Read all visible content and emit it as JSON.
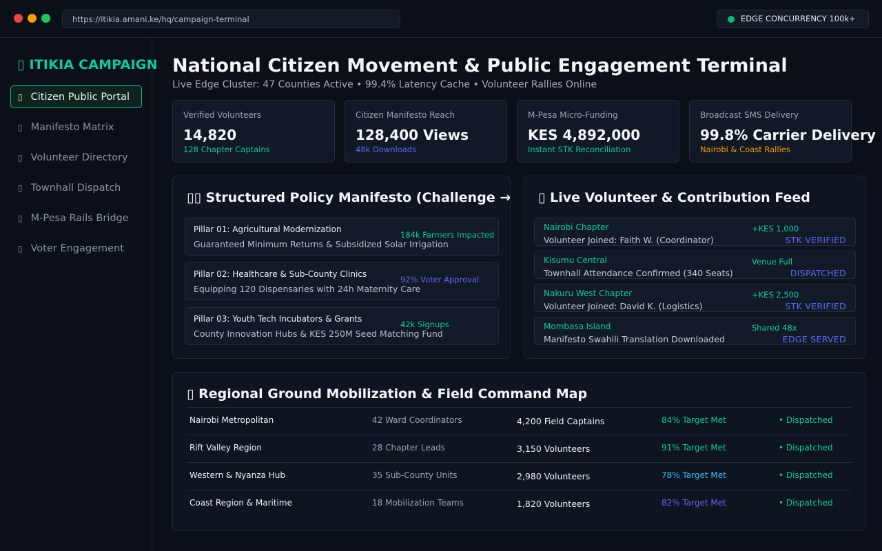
{
  "browser": {
    "url": "https://itikia.amani.ke/hq/campaign-terminal",
    "edge_status": "EDGE CONCURRENCY 100k+"
  },
  "sidebar": {
    "brand": "ITIKIA CAMPAIGN",
    "brand_icon": "glyph-placeholder-icon",
    "items": [
      {
        "label": "Citizen Public Portal",
        "icon": "glyph-placeholder-icon",
        "active": true
      },
      {
        "label": "Manifesto Matrix",
        "icon": "glyph-placeholder-icon",
        "active": false
      },
      {
        "label": "Volunteer Directory",
        "icon": "glyph-placeholder-icon",
        "active": false
      },
      {
        "label": "Townhall Dispatch",
        "icon": "glyph-placeholder-icon",
        "active": false
      },
      {
        "label": "M-Pesa Rails Bridge",
        "icon": "glyph-placeholder-icon",
        "active": false
      },
      {
        "label": "Voter Engagement",
        "icon": "glyph-placeholder-icon",
        "active": false
      }
    ]
  },
  "header": {
    "title": "National Citizen Movement & Public Engagement Terminal",
    "subtitle": "Live Edge Cluster: 47 Counties Active • 99.4% Latency Cache • Volunteer Rallies Online"
  },
  "stats": [
    {
      "label": "Verified Volunteers",
      "value": "14,820",
      "sub": "128 Chapter Captains",
      "sub_color": "#10c8a0"
    },
    {
      "label": "Citizen Manifesto Reach",
      "value": "128,400 Views",
      "sub": "48k Downloads",
      "sub_color": "#6366f1"
    },
    {
      "label": "M-Pesa Micro-Funding",
      "value": "KES 4,892,000",
      "sub": "Instant STK Reconciliation",
      "sub_color": "#10c8a0"
    },
    {
      "label": "Broadcast SMS Delivery",
      "value": "99.8% Carrier Delivery",
      "sub": "Nairobi & Coast Rallies",
      "sub_color": "#f59e0b"
    }
  ],
  "manifesto": {
    "title": "Structured Policy Manifesto (Challenge → Solution)",
    "icon": "glyph-placeholder-icon",
    "pillars": [
      {
        "title": "Pillar 01: Agricultural Modernization",
        "desc": "Guaranteed Minimum Returns & Subsidized Solar Irrigation",
        "metric": "184k Farmers Impacted",
        "metric_color": "#10c8a0"
      },
      {
        "title": "Pillar 02: Healthcare & Sub-County Clinics",
        "desc": "Equipping 120 Dispensaries with 24h Maternity Care",
        "metric": "92% Voter Approval",
        "metric_color": "#6366f1"
      },
      {
        "title": "Pillar 03: Youth Tech Incubators & Grants",
        "desc": "County Innovation Hubs & KES 250M Seed Matching Fund",
        "metric": "42k Signups",
        "metric_color": "#10c8a0"
      }
    ]
  },
  "feed": {
    "title": "Live Volunteer & Contribution Feed",
    "icon": "glyph-placeholder-icon",
    "items": [
      {
        "chapter": "Nairobi Chapter",
        "desc": "Volunteer Joined: Faith W. (Coordinator)",
        "amount": "+KES 1,000",
        "status": "STK VERIFIED"
      },
      {
        "chapter": "Kisumu Central",
        "desc": "Townhall Attendance Confirmed (340 Seats)",
        "amount": "Venue Full",
        "status": "DISPATCHED"
      },
      {
        "chapter": "Nakuru West Chapter",
        "desc": "Volunteer Joined: David K. (Logistics)",
        "amount": "+KES 2,500",
        "status": "STK VERIFIED"
      },
      {
        "chapter": "Mombasa Island",
        "desc": "Manifesto Swahili Translation Downloaded",
        "amount": "Shared 48x",
        "status": "EDGE SERVED"
      }
    ]
  },
  "map": {
    "title": "Regional Ground Mobilization & Field Command Map",
    "icon": "glyph-placeholder-icon",
    "rows": [
      {
        "region": "Nairobi Metropolitan",
        "units": "42 Ward Coordinators",
        "count": "4,200 Field Captains",
        "target": "84% Target Met",
        "target_color": "#10c8a0",
        "status": "• Dispatched"
      },
      {
        "region": "Rift Valley Region",
        "units": "28 Chapter Leads",
        "count": "3,150 Volunteers",
        "target": "91% Target Met",
        "target_color": "#10c8a0",
        "status": "• Dispatched"
      },
      {
        "region": "Western & Nyanza Hub",
        "units": "35 Sub-County Units",
        "count": "2,980 Volunteers",
        "target": "78% Target Met",
        "target_color": "#38bdf8",
        "status": "• Dispatched"
      },
      {
        "region": "Coast Region & Maritime",
        "units": "18 Mobilization Teams",
        "count": "1,820 Volunteers",
        "target": "82% Target Met",
        "target_color": "#6366f1",
        "status": "• Dispatched"
      }
    ]
  },
  "colors": {
    "accent": "#10c8a0",
    "indigo": "#6366f1",
    "amber": "#f59e0b",
    "background": "#0b0f17"
  }
}
